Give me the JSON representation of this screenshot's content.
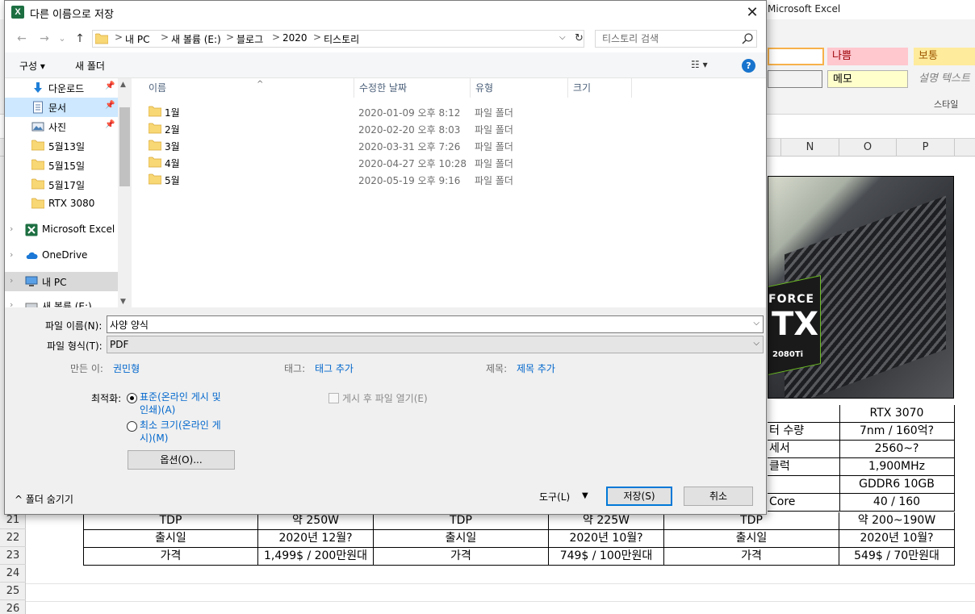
{
  "excel": {
    "app_title": "Microsoft Excel",
    "styles": {
      "bad": "나쁨",
      "neutral": "보통",
      "note": "메모",
      "explanatory": "설명 텍스트",
      "group_label": "스타일"
    },
    "columns": [
      "N",
      "O",
      "P"
    ],
    "rows": [
      "21",
      "22",
      "23",
      "24",
      "25",
      "26"
    ],
    "image_text": {
      "line1": "FORCE",
      "line2": "TX",
      "line3": "2080Ti"
    },
    "right_table": [
      {
        "label": "",
        "value": "RTX 3070"
      },
      {
        "label": "터 수량",
        "value": "7nm / 160억?"
      },
      {
        "label": "세서",
        "value": "2560~?"
      },
      {
        "label": "클럭",
        "value": "1,900MHz"
      },
      {
        "label": "",
        "value": "GDDR6 10GB"
      },
      {
        "label": "Core",
        "value": "40 / 160"
      }
    ],
    "bottom_table": [
      [
        "TDP",
        "약 250W",
        "TDP",
        "약 225W",
        "TDP",
        "약 200~190W"
      ],
      [
        "출시일",
        "2020년 12월?",
        "출시일",
        "2020년 10월?",
        "출시일",
        "2020년 10월?"
      ],
      [
        "가격",
        "1,499$ / 200만원대",
        "가격",
        "749$ / 100만원대",
        "가격",
        "549$ / 70만원대"
      ]
    ]
  },
  "dialog": {
    "title": "다른 이름으로 저장",
    "close_glyph": "✕",
    "nav": {
      "back": "←",
      "forward": "→",
      "recent": "⌄",
      "up": "↑"
    },
    "breadcrumb": [
      "내 PC",
      "새 볼륨 (E:)",
      "블로그",
      "2020",
      "티스토리"
    ],
    "breadcrumb_sep": ">",
    "refresh_glyph": "↻",
    "search_placeholder": "티스토리 검색",
    "toolbar": {
      "organize": "구성 ▾",
      "new_folder": "새 폴더",
      "view": "☷ ▾",
      "help": "?"
    },
    "nav_pane": [
      {
        "label": "다운로드",
        "icon": "download-icon",
        "pinned": true
      },
      {
        "label": "문서",
        "icon": "document-icon",
        "pinned": true,
        "selected": true
      },
      {
        "label": "사진",
        "icon": "picture-icon",
        "pinned": true
      },
      {
        "label": "5월13일",
        "icon": "folder-icon"
      },
      {
        "label": "5월15일",
        "icon": "folder-icon"
      },
      {
        "label": "5월17일",
        "icon": "folder-icon"
      },
      {
        "label": "RTX 3080",
        "icon": "folder-icon"
      },
      {
        "label": "Microsoft Excel",
        "icon": "excel-icon"
      },
      {
        "label": "OneDrive",
        "icon": "cloud-icon"
      },
      {
        "label": "내 PC",
        "icon": "pc-icon"
      },
      {
        "label": "새 볼륨 (E:)",
        "icon": "drive-icon"
      }
    ],
    "pin_glyph": "📌",
    "columns": {
      "name": "이름",
      "date": "수정한 날짜",
      "type": "유형",
      "size": "크기"
    },
    "sort_glyph": "^",
    "files": [
      {
        "name": "1월",
        "date": "2020-01-09 오후 8:12",
        "type": "파일 폴더"
      },
      {
        "name": "2월",
        "date": "2020-02-20 오후 8:03",
        "type": "파일 폴더"
      },
      {
        "name": "3월",
        "date": "2020-03-31 오후 7:26",
        "type": "파일 폴더"
      },
      {
        "name": "4월",
        "date": "2020-04-27 오후 10:28",
        "type": "파일 폴더"
      },
      {
        "name": "5월",
        "date": "2020-05-19 오후 9:16",
        "type": "파일 폴더"
      }
    ],
    "filename_label": "파일 이름(N):",
    "filename_value": "사양 양식",
    "filetype_label": "파일 형식(T):",
    "filetype_value": "PDF",
    "authors_label": "만든 이:",
    "authors_value": "권민형",
    "tags_label": "태그:",
    "tags_value": "태그 추가",
    "subject_label": "제목:",
    "subject_value": "제목 추가",
    "optimize_label": "최적화:",
    "optimize_standard": "표준(온라인 게시 및 인쇄)(A)",
    "optimize_minimum": "최소 크기(온라인 게시)(M)",
    "open_after": "게시 후 파일 열기(E)",
    "options_button": "옵션(O)...",
    "hide_folders": "^  폴더 숨기기",
    "tools_label": "도구(L)",
    "tools_dd": "▼",
    "save_label": "저장(S)",
    "cancel_label": "취소"
  },
  "colors": {
    "accent": "#0078d7",
    "link": "#0066cc",
    "excel_green": "#1d6f42",
    "folder": "#f8d775"
  }
}
